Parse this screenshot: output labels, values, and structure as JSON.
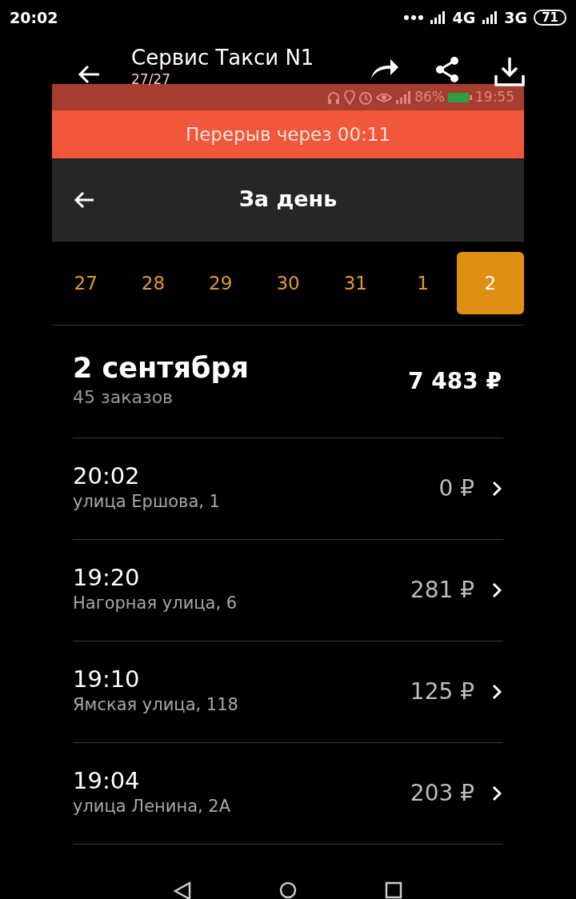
{
  "status_bar": {
    "time": "20:02",
    "network_1": "4G",
    "network_2": "3G",
    "battery": "71"
  },
  "viewer": {
    "title": "Сервис Такси N1",
    "counter": "27/27"
  },
  "screenshot": {
    "status_bar": {
      "battery": "86%",
      "time": "19:55"
    },
    "banner": "Перерыв через 00:11",
    "header": {
      "title": "За день"
    },
    "days": [
      {
        "label": "27",
        "selected": false
      },
      {
        "label": "28",
        "selected": false
      },
      {
        "label": "29",
        "selected": false
      },
      {
        "label": "30",
        "selected": false
      },
      {
        "label": "31",
        "selected": false
      },
      {
        "label": "1",
        "selected": false
      },
      {
        "label": "2",
        "selected": true
      }
    ],
    "summary": {
      "date": "2 сентября",
      "orders": "45 заказов",
      "total": "7 483 ₽"
    },
    "orders": [
      {
        "time": "20:02",
        "address": "улица Ершова, 1",
        "price": "0 ₽"
      },
      {
        "time": "19:20",
        "address": "Нагорная улица, 6",
        "price": "281 ₽"
      },
      {
        "time": "19:10",
        "address": "Ямская улица, 118",
        "price": "125 ₽"
      },
      {
        "time": "19:04",
        "address": "улица Ленина, 2А",
        "price": "203 ₽"
      }
    ]
  }
}
